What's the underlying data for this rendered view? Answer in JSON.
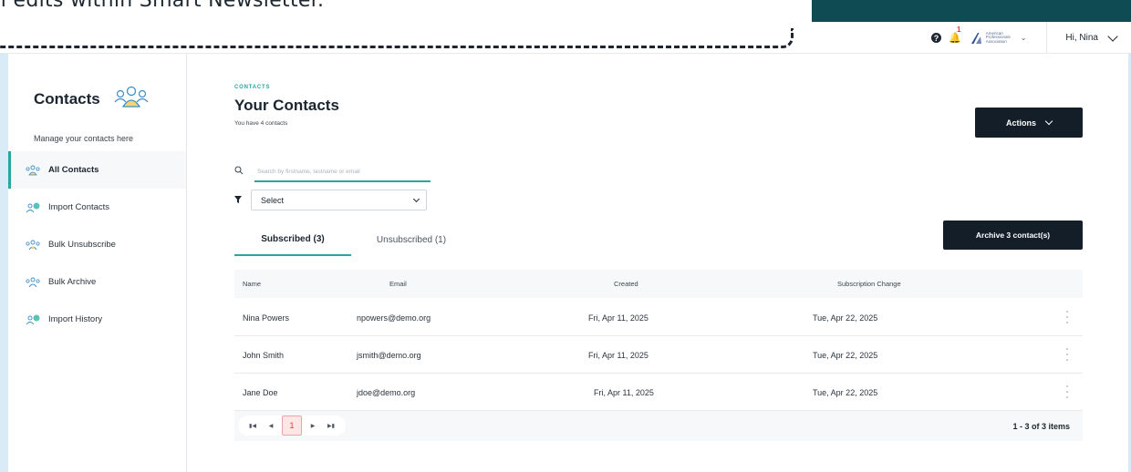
{
  "tooltip": {
    "text": "al edits within Smart Newsletter."
  },
  "header": {
    "help_icon": "question-circle-icon",
    "notifications_count": "1",
    "org_logo_text": "American Professionals Association",
    "user_greeting": "Hi, Nina"
  },
  "sidebar": {
    "title": "Contacts",
    "subtitle": "Manage your contacts here",
    "items": [
      {
        "label": "All Contacts",
        "icon": "contacts-group-icon",
        "active": true
      },
      {
        "label": "Import Contacts",
        "icon": "import-contacts-icon",
        "active": false
      },
      {
        "label": "Bulk Unsubscribe",
        "icon": "unsubscribe-group-icon",
        "active": false
      },
      {
        "label": "Bulk Archive",
        "icon": "archive-group-icon",
        "active": false
      },
      {
        "label": "Import History",
        "icon": "import-history-icon",
        "active": false
      }
    ]
  },
  "main": {
    "eyebrow": "CONTACTS",
    "title": "Your Contacts",
    "subtitle": "You have 4 contacts",
    "actions_label": "Actions",
    "search": {
      "placeholder": "Search by firstname, lastname or email"
    },
    "filter": {
      "selected": "Select"
    },
    "tabs": [
      {
        "label": "Subscribed (3)",
        "active": true
      },
      {
        "label": "Unsubscribed (1)",
        "active": false
      }
    ],
    "archive_label": "Archive 3 contact(s)",
    "table": {
      "columns": [
        "Name",
        "Email",
        "Created",
        "Subscription Change"
      ],
      "rows": [
        {
          "name": "Nina Powers",
          "email": "npowers@demo.org",
          "created": "Fri, Apr 11, 2025",
          "change": "Tue, Apr 22, 2025"
        },
        {
          "name": "John Smith",
          "email": "jsmith@demo.org",
          "created": "Fri, Apr 11, 2025",
          "change": "Tue, Apr 22, 2025"
        },
        {
          "name": "Jane Doe",
          "email": "jdoe@demo.org",
          "created": "Fri, Apr 11, 2025",
          "change": "Tue, Apr 22, 2025"
        }
      ]
    },
    "pagination": {
      "current_page": "1",
      "info": "1 - 3 of 3 items"
    }
  },
  "colors": {
    "accent": "#2aa5a1",
    "dark": "#141e28",
    "topbar": "#0f4b52",
    "alert": "#e0343e"
  }
}
